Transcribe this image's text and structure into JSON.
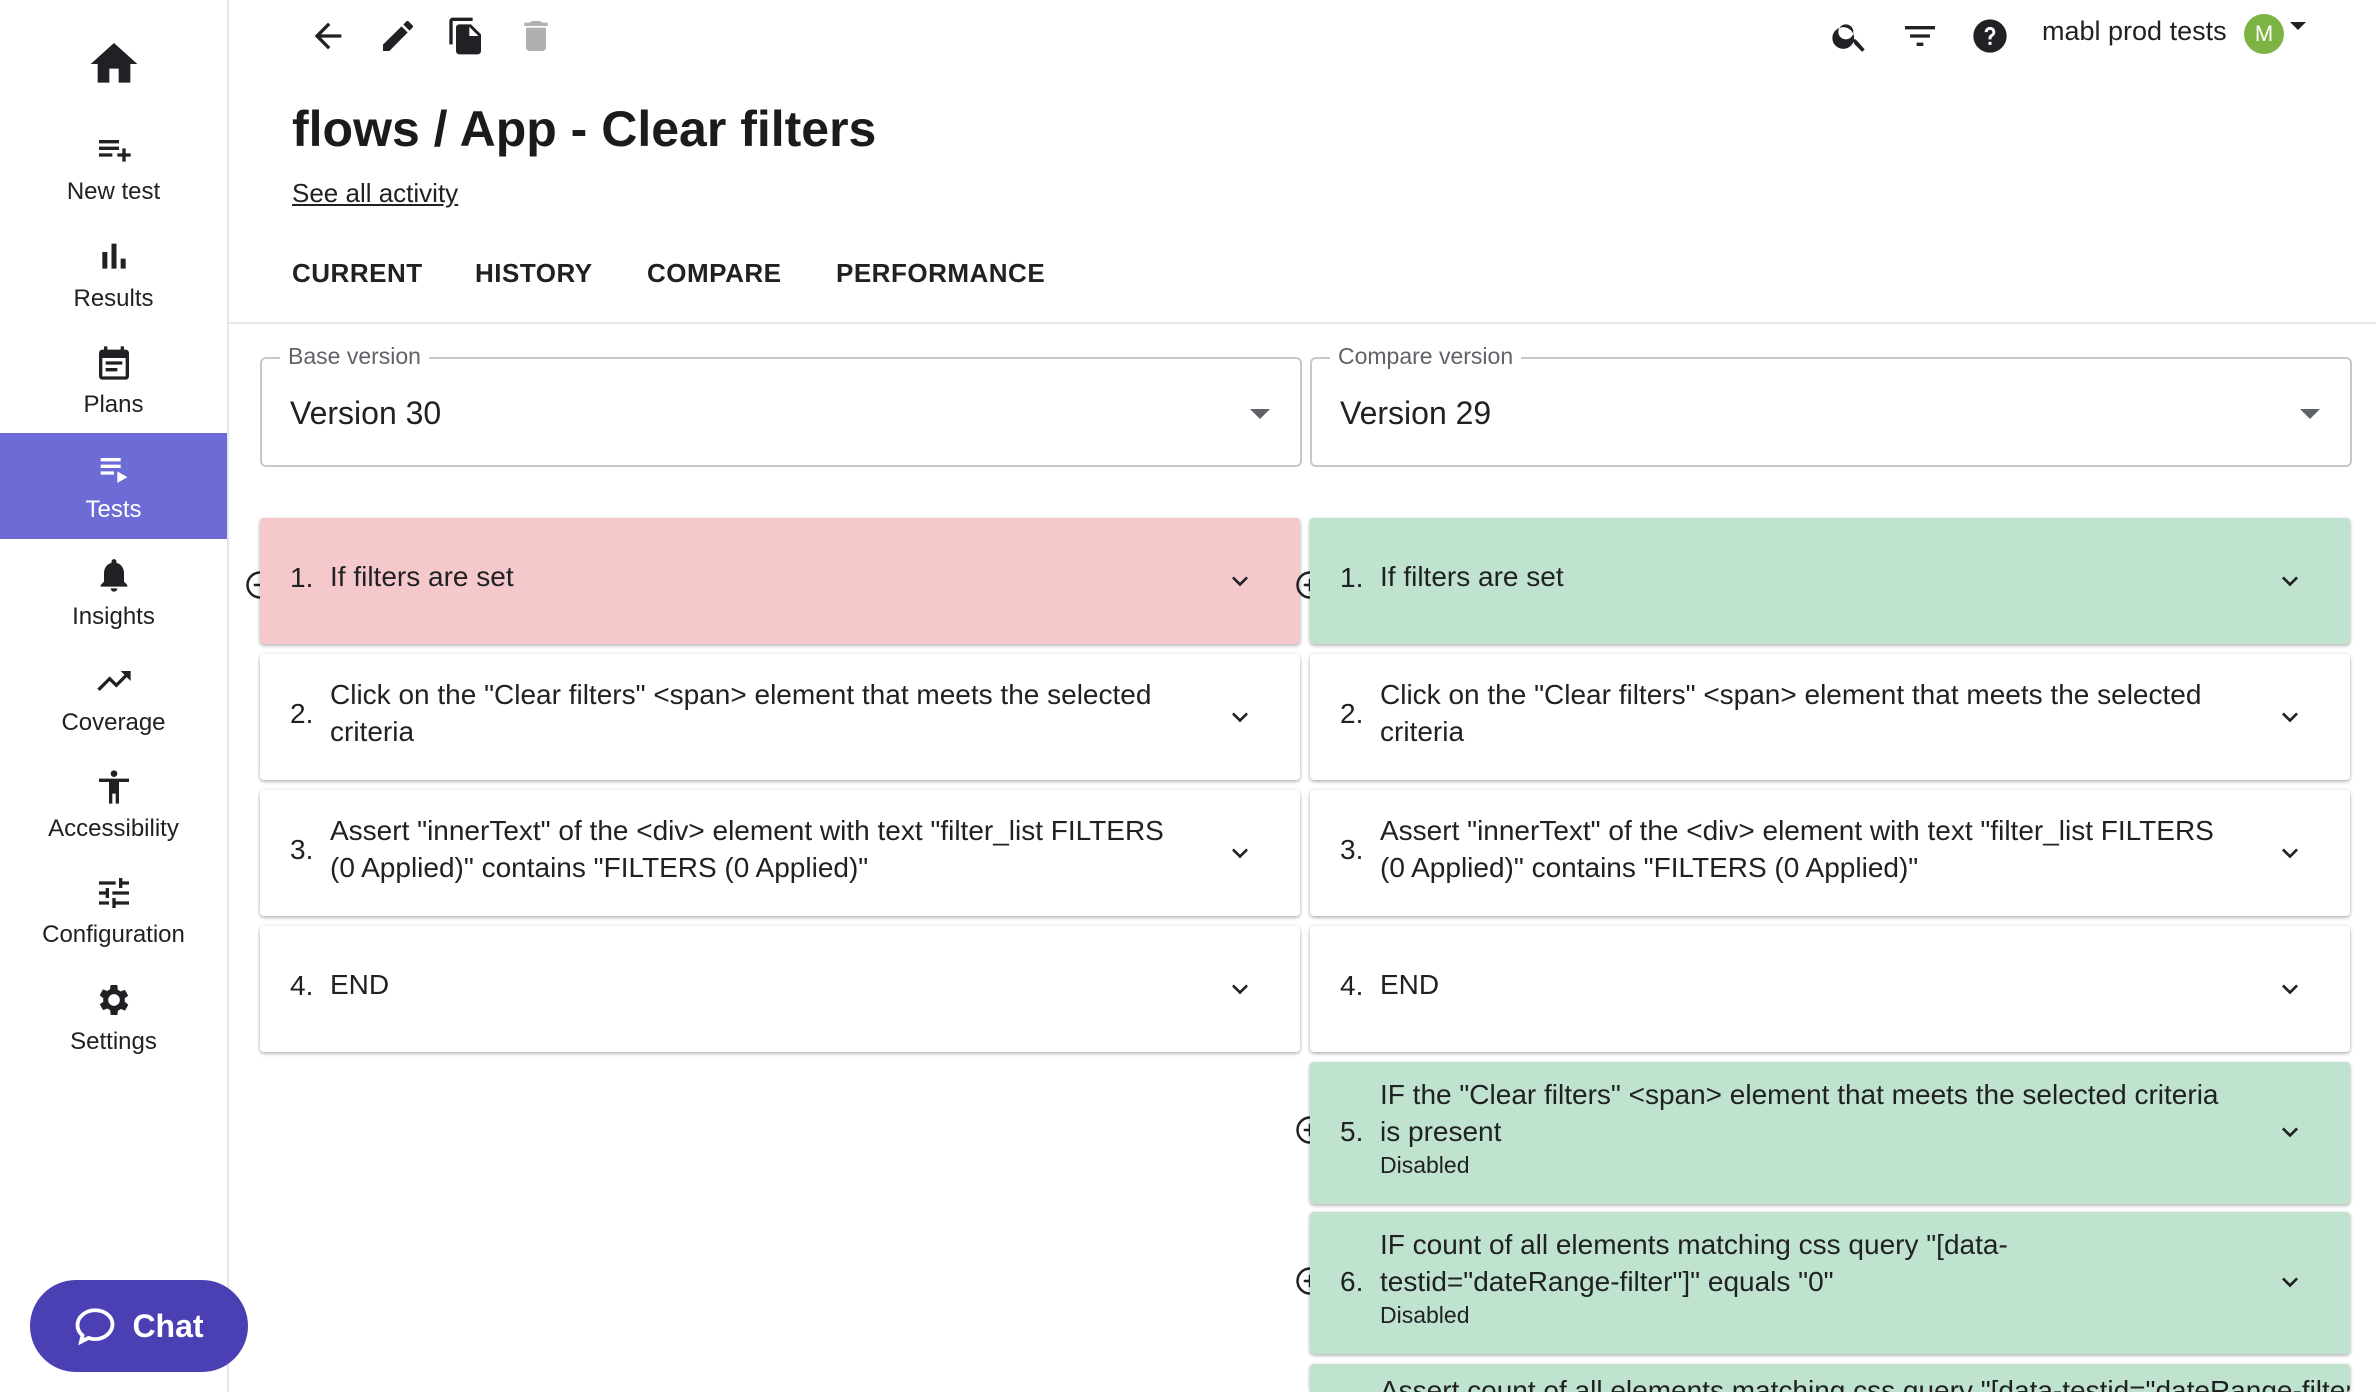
{
  "sidebar": {
    "items": [
      {
        "label": "New test",
        "icon": "playlist-add-icon"
      },
      {
        "label": "Results",
        "icon": "bar-chart-icon"
      },
      {
        "label": "Plans",
        "icon": "calendar-icon"
      },
      {
        "label": "Tests",
        "icon": "playlist-play-icon",
        "active": true
      },
      {
        "label": "Insights",
        "icon": "bell-icon"
      },
      {
        "label": "Coverage",
        "icon": "trending-up-icon"
      },
      {
        "label": "Accessibility",
        "icon": "accessibility-icon"
      },
      {
        "label": "Configuration",
        "icon": "tune-icon"
      },
      {
        "label": "Settings",
        "icon": "gear-icon"
      }
    ],
    "chat_label": "Chat"
  },
  "header": {
    "title": "flows / App - Clear filters",
    "activity_link": "See all activity",
    "user": "mabl prod tests",
    "avatar_initial": "M"
  },
  "tabs": [
    {
      "label": "CURRENT"
    },
    {
      "label": "HISTORY"
    },
    {
      "label": "COMPARE"
    },
    {
      "label": "PERFORMANCE"
    }
  ],
  "compare": {
    "base_label": "Base version",
    "base_value": "Version 30",
    "compare_label": "Compare version",
    "compare_value": "Version 29"
  },
  "left_steps": [
    {
      "num": "1.",
      "text": "If filters are set",
      "status": "removed"
    },
    {
      "num": "2.",
      "text": "Click on the \"Clear filters\" <span> element that meets the selected criteria"
    },
    {
      "num": "3.",
      "text": "Assert \"innerText\" of the <div> element with text \"filter_list FILTERS (0 Applied)\" contains \"FILTERS (0 Applied)\""
    },
    {
      "num": "4.",
      "text": "END"
    }
  ],
  "right_steps": [
    {
      "num": "1.",
      "text": "If filters are set",
      "status": "added"
    },
    {
      "num": "2.",
      "text": "Click on the \"Clear filters\" <span> element that meets the selected criteria"
    },
    {
      "num": "3.",
      "text": "Assert \"innerText\" of the <div> element with text \"filter_list FILTERS (0 Applied)\" contains \"FILTERS (0 Applied)\""
    },
    {
      "num": "4.",
      "text": "END"
    },
    {
      "num": "5.",
      "text": "IF the \"Clear filters\" <span> element that meets the selected criteria is present",
      "sub": "Disabled",
      "status": "added"
    },
    {
      "num": "6.",
      "text": "IF count of all elements matching css query \"[data-testid=\"dateRange-filter\"]\" equals \"0\"",
      "sub": "Disabled",
      "status": "added"
    },
    {
      "num": "",
      "text": "Assert count of all elements matching css query \"[data-testid=\"dateRange-filter\"]\"",
      "status": "added"
    }
  ],
  "colors": {
    "accent": "#6d6bd6",
    "chat": "#4b3fb4",
    "removed": "#f5c9cc",
    "added": "#bfe3cf",
    "avatar": "#7cb342"
  }
}
